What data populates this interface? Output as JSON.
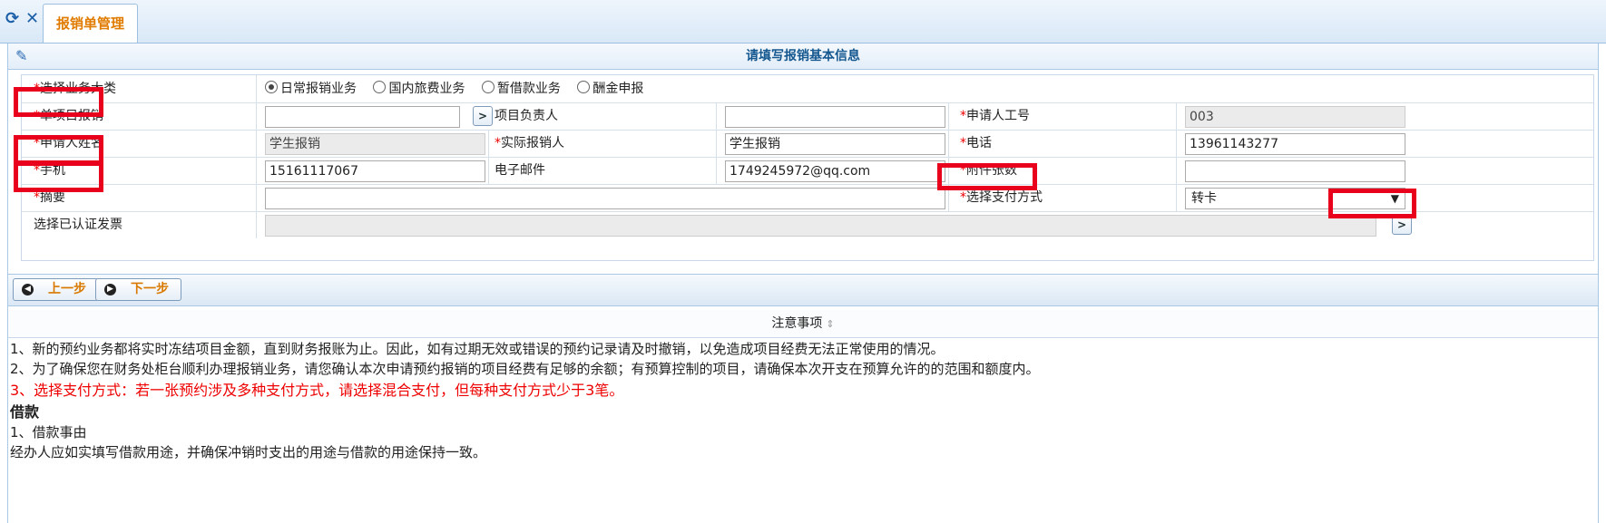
{
  "tabbar": {
    "tab_label": "报销单管理",
    "refresh_icon": "refresh-icon",
    "close_icon": "close-icon"
  },
  "section": {
    "title": "请填写报销基本信息",
    "icon": "pencil-icon"
  },
  "form": {
    "category_label": "选择业务大类",
    "category_options": [
      "日常报销业务",
      "国内旅费业务",
      "暂借款业务",
      "酬金申报"
    ],
    "category_selected": "日常报销业务",
    "single_project_label": "单项目报销",
    "single_project_value": "",
    "project_leader_label": "项目负责人",
    "project_leader_value": "",
    "applicant_id_label": "申请人工号",
    "applicant_id_value": "003",
    "applicant_name_label": "申请人姓名",
    "applicant_name_value": "学生报销",
    "actual_reimburser_label": "实际报销人",
    "actual_reimburser_value": "学生报销",
    "phone_label": "电话",
    "phone_value": "13961143277",
    "mobile_label": "手机",
    "mobile_value": "15161117067",
    "email_label": "电子邮件",
    "email_value": "1749245972@qq.com",
    "attachments_label": "附件张数",
    "attachments_value": "",
    "summary_label": "摘要",
    "summary_value": "",
    "payment_label": "选择支付方式",
    "payment_value": "转卡",
    "invoice_label": "选择已认证发票",
    "invoice_value": "",
    "required_mark": "*",
    "more_glyph": ">"
  },
  "nav": {
    "prev_label": "上一步",
    "next_label": "下一步"
  },
  "notice": {
    "header": "注意事项",
    "line1": "1、新的预约业务都将实时冻结项目金额，直到财务报账为止。因此，如有过期无效或错误的预约记录请及时撤销，以免造成项目经费无法正常使用的情况。",
    "line2": "2、为了确保您在财务处柜台顺利办理报销业务，请您确认本次申请预约报销的项目经费有足够的余额；有预算控制的项目，请确保本次开支在预算允许的的范围和额度内。",
    "line3": "3、选择支付方式：若一张预约涉及多种支付方式，请选择混合支付，但每种支付方式少于3笔。",
    "heading": "借款",
    "item1": "1、借款事由",
    "item1_text": "经办人应如实填写借款用途，并确保冲销时支出的用途与借款的用途保持一致。"
  },
  "colors": {
    "accent": "#e07b00",
    "required": "#e00000",
    "highlight": "#e8001c",
    "title": "#14578f"
  }
}
